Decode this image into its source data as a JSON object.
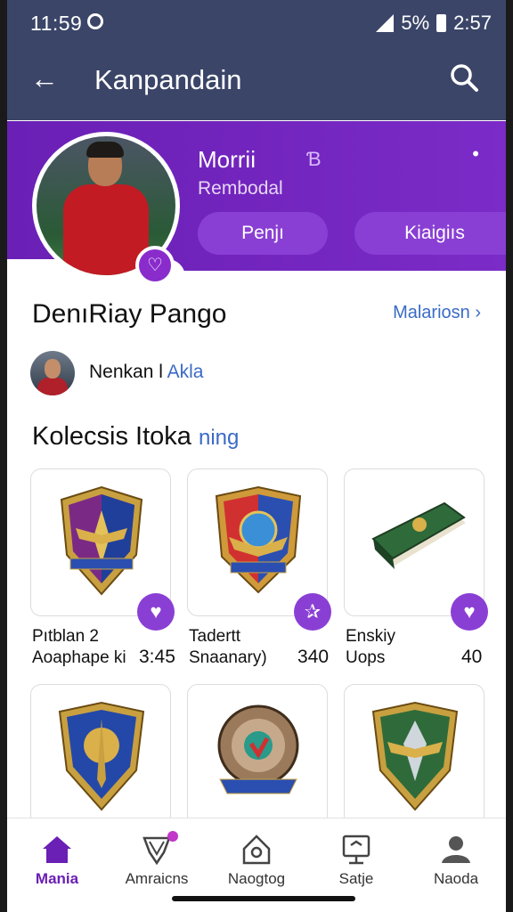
{
  "status": {
    "time": "11:59",
    "battery": "5%",
    "clock": "2:57"
  },
  "appbar": {
    "title": "Kanpandain"
  },
  "header": {
    "name": "Morrii",
    "subtitle": "Rembodal",
    "button1": "Penjı",
    "button2": "Kiaigiıs"
  },
  "section": {
    "title": "DenıRiay Pango",
    "link": "Malariosn ›"
  },
  "owner": {
    "name": "Nenkan l",
    "accent": "Akla"
  },
  "collection": {
    "title": "Kolecsis Itoka",
    "accent": "ning"
  },
  "items": [
    {
      "name": "Pıtblan 2",
      "sub": "Aoaphape ki",
      "price": "3:45",
      "badge": "heart-icon"
    },
    {
      "name": "Tadertt",
      "sub": "Snaanary)",
      "price": "340",
      "badge": "star-icon"
    },
    {
      "name": "Enskiy",
      "sub": "Uops",
      "price": "40",
      "badge": "heart-icon"
    }
  ],
  "nav": [
    {
      "label": "Mania",
      "icon": "home-icon"
    },
    {
      "label": "Amraicns",
      "icon": "trophy-icon"
    },
    {
      "label": "Naogtog",
      "icon": "house-outline-icon"
    },
    {
      "label": "Satje",
      "icon": "store-icon"
    },
    {
      "label": "Naoda",
      "icon": "profile-icon"
    }
  ],
  "colors": {
    "header": "#3b4568",
    "accent": "#7b2bc7",
    "link": "#3a6bc5"
  }
}
